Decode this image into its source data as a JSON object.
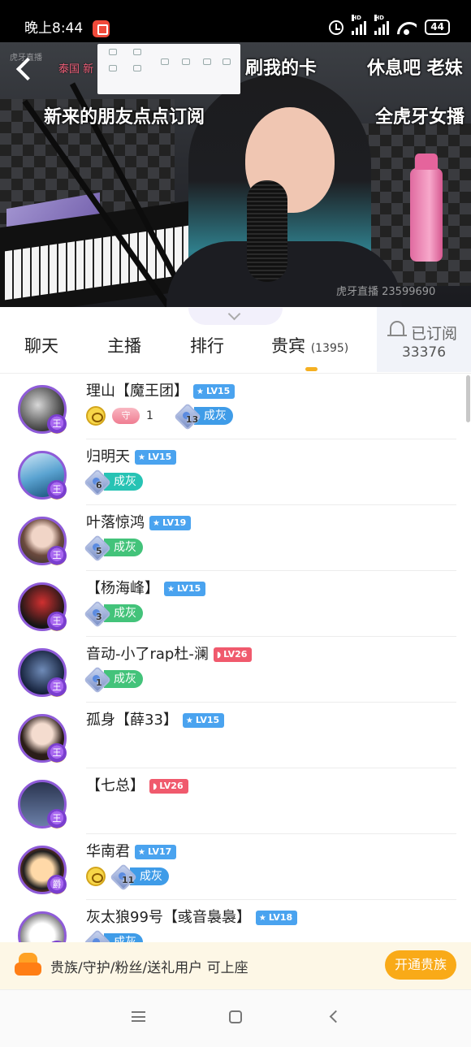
{
  "status_bar": {
    "time": "晚上8:44",
    "battery": "44",
    "signal_hd": "HD"
  },
  "video": {
    "overlays": [
      "刷我的卡",
      "休息吧 老妹",
      "新来的朋友点点订阅",
      "全虎牙女播"
    ],
    "channel_name": "泰国 新",
    "watermark": "虎牙直播 23599690",
    "logo_text": "虎牙直播"
  },
  "tabs": {
    "chat": "聊天",
    "anchor": "主播",
    "rank": "排行",
    "vip": "贵宾",
    "vip_count": "(1395)"
  },
  "subscribe": {
    "label": "已订阅",
    "count": "33376"
  },
  "rows": [
    {
      "name": "理山【魔王团】",
      "level": "LV15",
      "level_color": "blue",
      "badge": "王",
      "guard": true,
      "guard_label": "守",
      "guard_count": "1",
      "fan_level": "13",
      "fan_name": "成灰",
      "fan_color": "blue"
    },
    {
      "name": "归明天",
      "level": "LV15",
      "level_color": "blue",
      "badge": "王",
      "fan_level": "6",
      "fan_name": "成灰",
      "fan_color": "teal"
    },
    {
      "name": "叶落惊鸿",
      "level": "LV19",
      "level_color": "blue",
      "badge": "王",
      "fan_level": "5",
      "fan_name": "成灰",
      "fan_color": "green"
    },
    {
      "name": "【杨海峰】",
      "level": "LV15",
      "level_color": "blue",
      "badge": "王",
      "fan_level": "3",
      "fan_name": "成灰",
      "fan_color": "green"
    },
    {
      "name": "音动-小了rap杜-澜",
      "level": "LV26",
      "level_color": "red",
      "badge": "王",
      "fan_level": "1",
      "fan_name": "成灰",
      "fan_color": "green"
    },
    {
      "name": "孤身【薛33】",
      "level": "LV15",
      "level_color": "blue",
      "badge": "王"
    },
    {
      "name": "【七总】",
      "level": "LV26",
      "level_color": "red",
      "badge": "王"
    },
    {
      "name": "华南君",
      "level": "LV17",
      "level_color": "blue",
      "badge": "爵",
      "coin": true,
      "fan_level": "11",
      "fan_name": "成灰",
      "fan_color": "blue"
    },
    {
      "name": "灰太狼99号【彧音裊裊】",
      "level": "LV18",
      "level_color": "blue",
      "badge": "王",
      "fan_level": "",
      "fan_name": "成灰",
      "fan_color": "blue"
    }
  ],
  "promo": {
    "text": "贵族/守护/粉丝/送礼用户 可上座",
    "button": "开通贵族"
  },
  "colors": {
    "accent": "#f9aa18",
    "avatar_ring": "#8e5bd8",
    "level_blue": "#4aa3ef",
    "level_red": "#f05a6d"
  },
  "icons": [
    "back-arrow-icon",
    "bell-icon",
    "crown-badge-icon",
    "fan-shield-icon",
    "sofa-icon",
    "menu-icon",
    "home-icon",
    "nav-back-icon"
  ]
}
